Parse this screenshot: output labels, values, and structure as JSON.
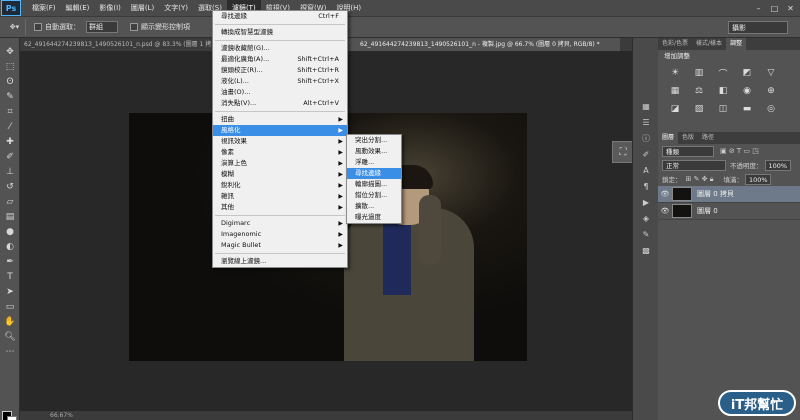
{
  "app": {
    "logo": "Ps"
  },
  "menubar": {
    "items": [
      "檔案(F)",
      "編輯(E)",
      "影像(I)",
      "圖層(L)",
      "文字(Y)",
      "選取(S)",
      "濾鏡(T)",
      "檢視(V)",
      "視窗(W)",
      "說明(H)"
    ],
    "active_index": 6
  },
  "options": {
    "tool_icon": "eyedropper-icon",
    "auto_select_label": "自動選取：",
    "auto_select_value": "群組",
    "show_transform_label": "顯示變形控制項",
    "workspace": "攝影"
  },
  "tabs": [
    {
      "label": "62_491644274239813_1490526101_n.psd @ 83.3% (圖層 1 拷貝, R"
    },
    {
      "label": "62_491644274239813_1490526101_n - 複製.jpg @ 66.7% (圖層 0 拷貝, RGB/8) *"
    }
  ],
  "filter_menu": {
    "items": [
      {
        "label": "尋找邊緣",
        "shortcut": "Ctrl+F"
      },
      {
        "sep": true
      },
      {
        "label": "轉換成智慧型濾鏡"
      },
      {
        "sep": true
      },
      {
        "label": "濾鏡收藏館(G)..."
      },
      {
        "label": "最適化廣角(A)...",
        "shortcut": "Shift+Ctrl+A"
      },
      {
        "label": "鏡頭校正(R)...",
        "shortcut": "Shift+Ctrl+R"
      },
      {
        "label": "液化(L)...",
        "shortcut": "Shift+Ctrl+X"
      },
      {
        "label": "油畫(O)..."
      },
      {
        "label": "消失點(V)...",
        "shortcut": "Alt+Ctrl+V"
      },
      {
        "sep": true
      },
      {
        "label": "扭曲",
        "sub": true
      },
      {
        "label": "風格化",
        "sub": true,
        "highlight": true
      },
      {
        "label": "視訊效果",
        "sub": true
      },
      {
        "label": "像素",
        "sub": true
      },
      {
        "label": "演算上色",
        "sub": true
      },
      {
        "label": "模糊",
        "sub": true
      },
      {
        "label": "銳利化",
        "sub": true
      },
      {
        "label": "雜訊",
        "sub": true
      },
      {
        "label": "其他",
        "sub": true
      },
      {
        "sep": true
      },
      {
        "label": "Digimarc",
        "sub": true
      },
      {
        "label": "Imagenomic",
        "sub": true
      },
      {
        "label": "Magic Bullet",
        "sub": true
      },
      {
        "sep": true
      },
      {
        "label": "瀏覽線上濾鏡..."
      }
    ]
  },
  "stylize_menu": {
    "items": [
      {
        "label": "突出分割..."
      },
      {
        "label": "風動效果..."
      },
      {
        "label": "浮雕..."
      },
      {
        "label": "尋找邊緣",
        "highlight": true
      },
      {
        "label": "輪廓描圖..."
      },
      {
        "label": "錯位分割..."
      },
      {
        "label": "擴散..."
      },
      {
        "label": "曝光過度"
      }
    ]
  },
  "panels": {
    "top_tabs": [
      "色彩/色票",
      "樣式/樣本",
      "調整"
    ],
    "adjustments_title": "增加調整",
    "layers_tabs": [
      "圖層",
      "色版",
      "路徑"
    ],
    "filter_kind": "種類",
    "blend_mode": "正常",
    "opacity_label": "不透明度：",
    "opacity_value": "100%",
    "lock_label": "鎖定：",
    "fill_label": "填滿：",
    "fill_value": "100%",
    "layers": [
      {
        "name": "圖層 0 拷貝",
        "selected": true
      },
      {
        "name": "圖層 0",
        "selected": false
      }
    ]
  },
  "status": {
    "text": "66.67%"
  },
  "watermark": "iT邦幫忙"
}
